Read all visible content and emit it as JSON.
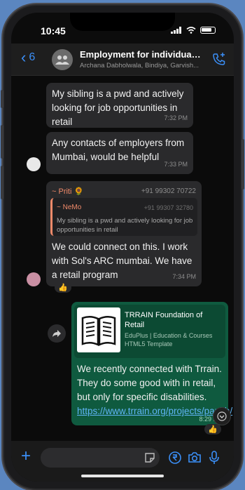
{
  "status": {
    "time": "10:45"
  },
  "header": {
    "back_count": "6",
    "title": "Employment for individuals...",
    "subtitle": "Archana Dabholwala, Bindiya, Garvish..."
  },
  "messages": {
    "m1": {
      "text": "My sibling is a pwd and actively looking for job opportunities in retail",
      "time": "7:32 PM"
    },
    "m2": {
      "text": "Any contacts of employers from Mumbai, would be helpful",
      "time": "7:33 PM"
    },
    "m3": {
      "sender": "~ Priti 🌻",
      "sender_phone": "+91 99302 70722",
      "quote_name": "~ NeMo",
      "quote_phone": "+91 99307 32780",
      "quote_text": "My sibling is a pwd and actively looking for job opportunities in retail",
      "text": "We could connect on this. I work with Sol's ARC mumbai. We have a retail program",
      "time": "7:34 PM",
      "reaction": "👍"
    },
    "m4": {
      "preview_title": "TRRAIN Foundation of Retail",
      "preview_sub": "EduPlus | Education & Courses HTML5 Template",
      "text": "We recently connected with Trrain. They do some good with in retail, but only for specific disabilities.",
      "link": "https://www.trrain.org/projects/pankh/",
      "time": "8:29 PM",
      "reaction": "👍"
    }
  },
  "composer": {
    "placeholder": ""
  },
  "colors": {
    "accent": "#3b8ff7",
    "outgoing": "#0f5a3f",
    "incoming": "#2a2a2c"
  }
}
